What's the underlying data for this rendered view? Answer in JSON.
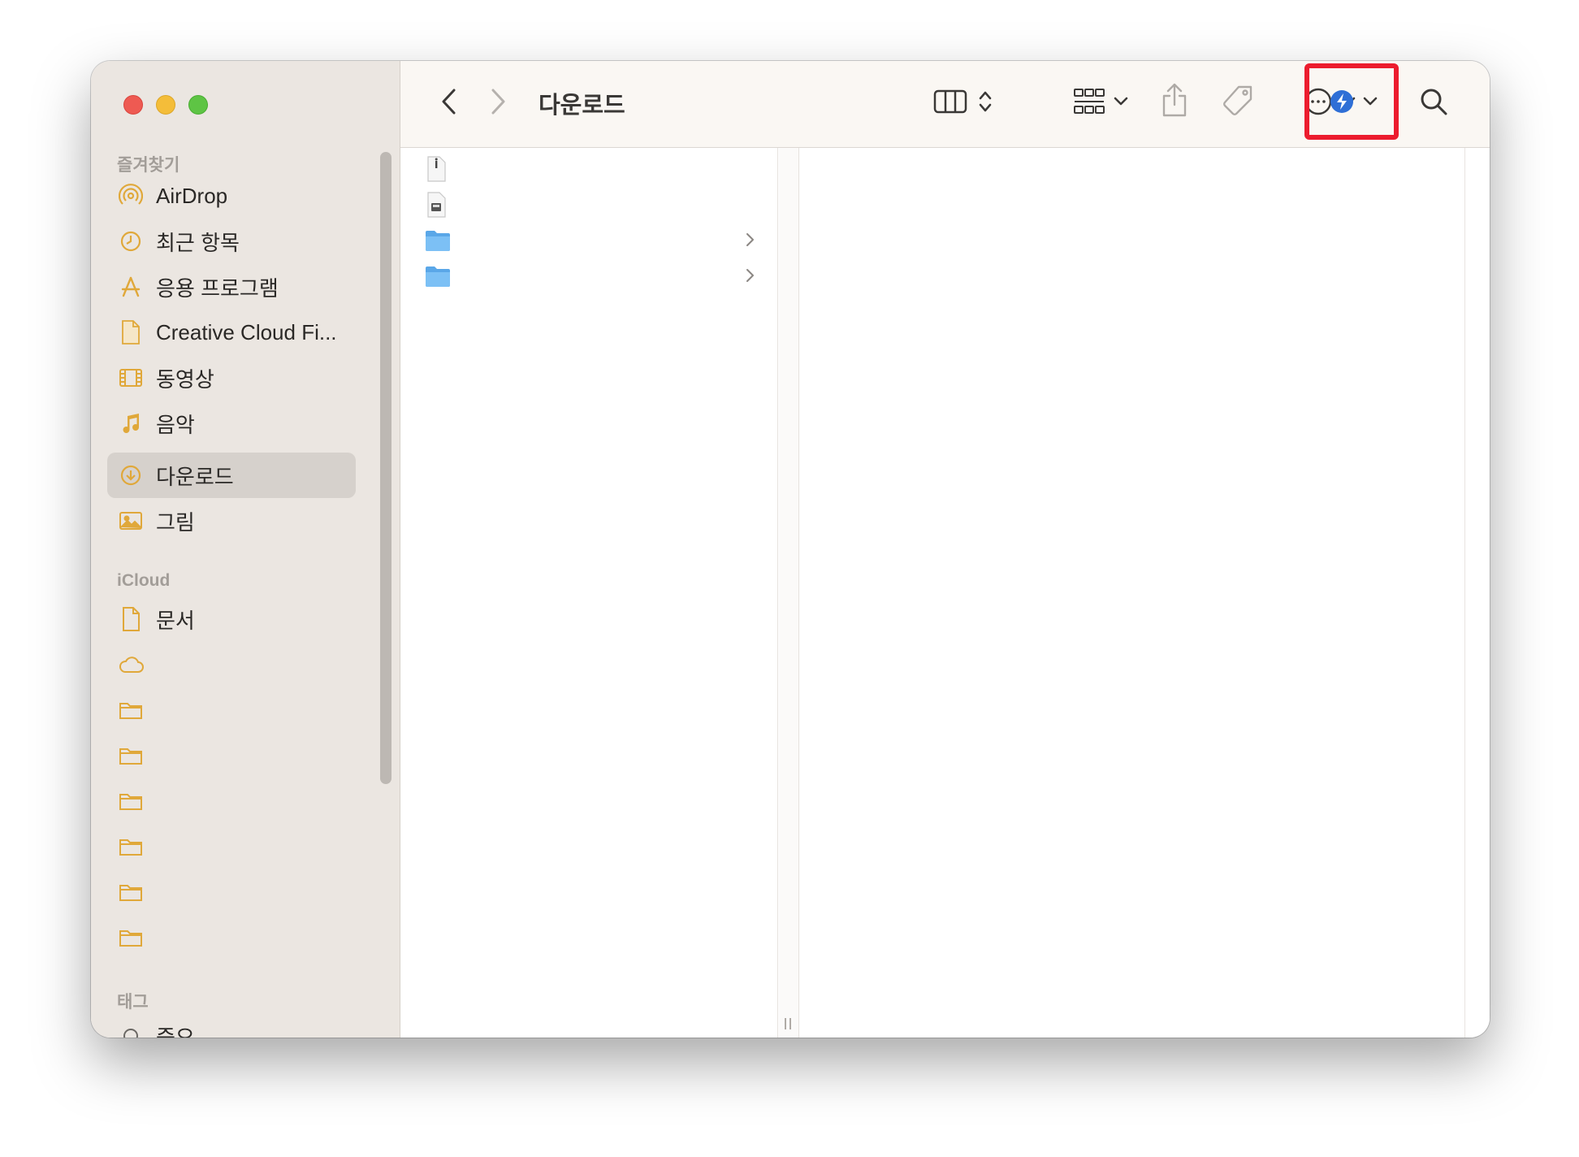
{
  "window": {
    "title": "다운로드"
  },
  "sidebar": {
    "sections": {
      "favorites": "즐겨찾기",
      "icloud": "iCloud",
      "tags": "태그"
    },
    "favorites": [
      {
        "label": "AirDrop",
        "icon": "airdrop-icon"
      },
      {
        "label": "최근 항목",
        "icon": "clock-icon"
      },
      {
        "label": "응용 프로그램",
        "icon": "applications-icon"
      },
      {
        "label": "Creative Cloud Fi...",
        "icon": "document-icon"
      },
      {
        "label": "동영상",
        "icon": "film-icon"
      },
      {
        "label": "음악",
        "icon": "music-note-icon"
      },
      {
        "label": "다운로드",
        "icon": "download-icon",
        "selected": true
      },
      {
        "label": "그림",
        "icon": "photo-icon"
      }
    ],
    "icloud": [
      {
        "label": "문서",
        "icon": "document-icon"
      }
    ],
    "tags": [
      {
        "label": "중요",
        "icon": "tag-circle-icon"
      }
    ]
  },
  "toolbar": {
    "title": "다운로드",
    "icons": [
      "back-icon",
      "forward-icon",
      "column-view-icon",
      "group-icon",
      "share-icon",
      "tag-icon",
      "more-icon",
      "extension-icon",
      "search-icon"
    ]
  },
  "colors": {
    "accent_highlight": "#ec1c2e",
    "folder_blue": "#5aa7e8",
    "sidebar_icon": "#e0a83a",
    "extension_blue": "#2f6fd6"
  }
}
